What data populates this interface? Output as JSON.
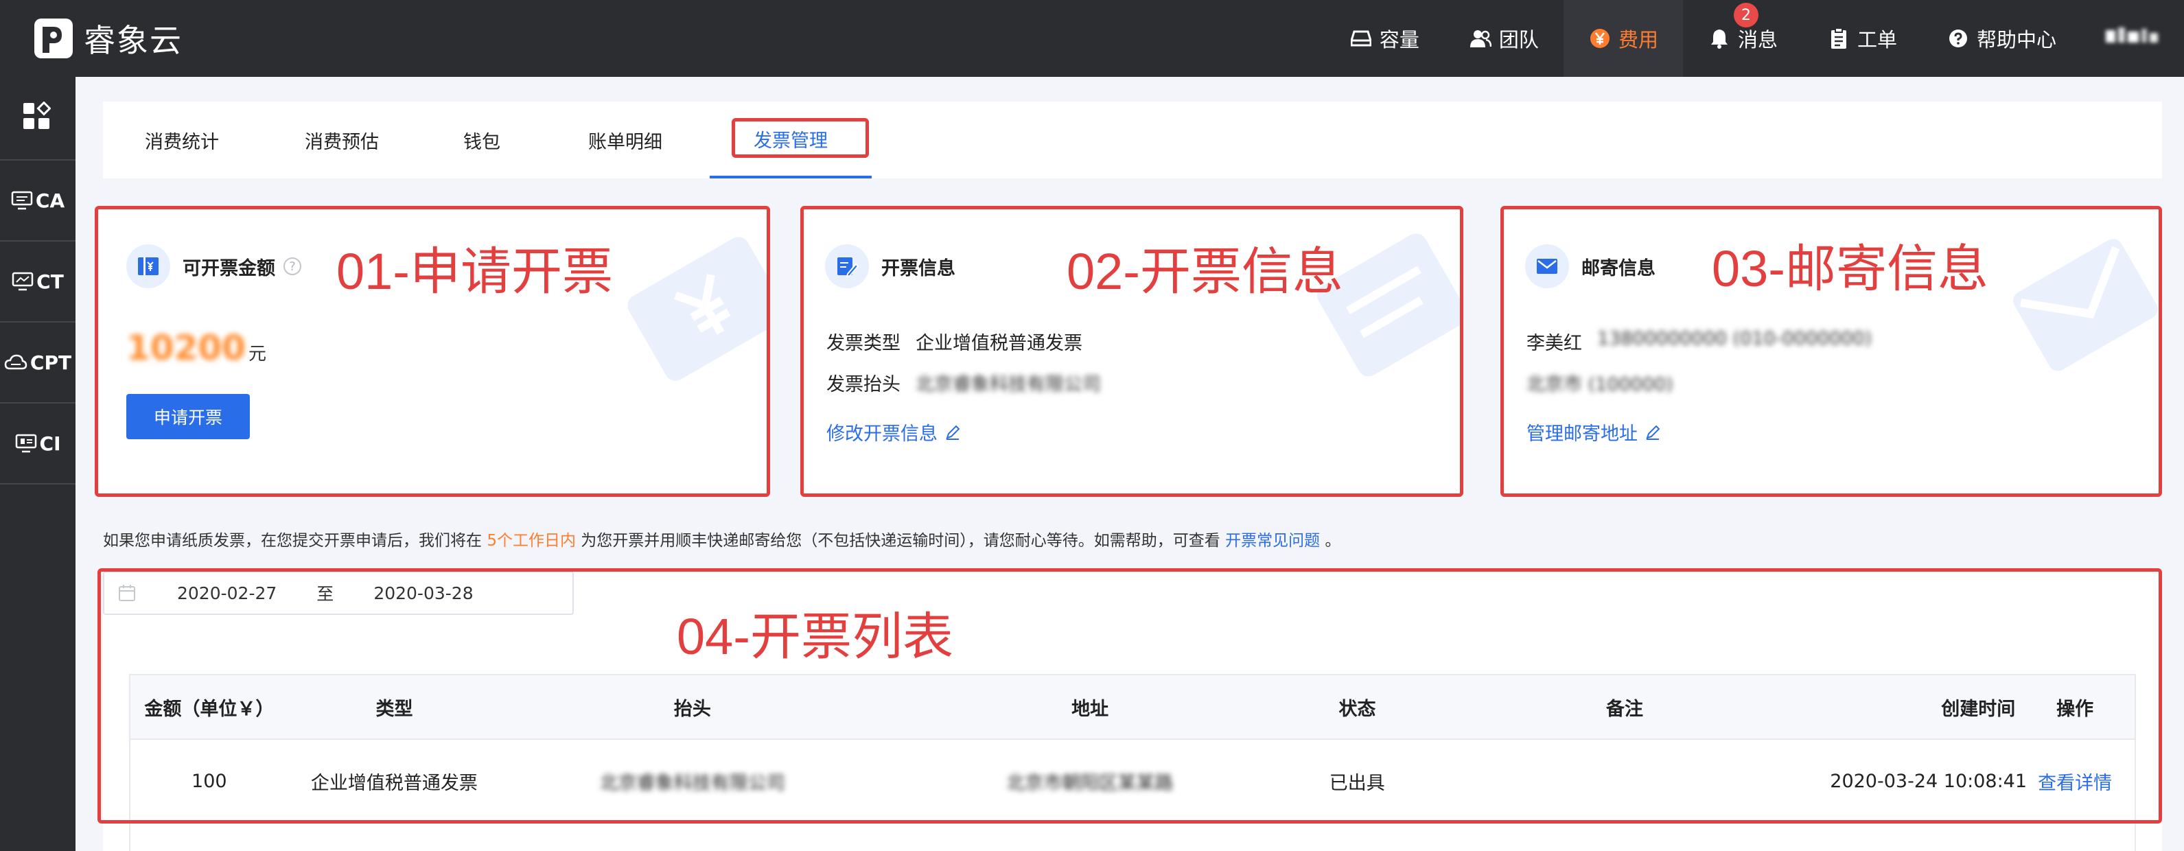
{
  "brand": {
    "name": "睿象云"
  },
  "topnav": {
    "items": [
      {
        "key": "capacity",
        "label": "容量",
        "icon": "disk-icon"
      },
      {
        "key": "team",
        "label": "团队",
        "icon": "team-icon"
      },
      {
        "key": "billing",
        "label": "费用",
        "icon": "yen-icon",
        "active": true
      },
      {
        "key": "messages",
        "label": "消息",
        "icon": "bell-icon",
        "badge": "2"
      },
      {
        "key": "tickets",
        "label": "工单",
        "icon": "clipboard-icon"
      },
      {
        "key": "help",
        "label": "帮助中心",
        "icon": "question-icon"
      }
    ]
  },
  "sidebar": {
    "items": [
      {
        "label": "",
        "icon": "apps-icon"
      },
      {
        "label": "CA",
        "icon": "monitor-icon"
      },
      {
        "label": "CT",
        "icon": "monitor-chart-icon"
      },
      {
        "label": "CPT",
        "icon": "cloud-icon"
      },
      {
        "label": "CI",
        "icon": "monitor-list-icon"
      }
    ]
  },
  "tabs": [
    "消费统计",
    "消费预估",
    "钱包",
    "账单明细",
    "发票管理"
  ],
  "active_tab": "发票管理",
  "cards": {
    "apply": {
      "title": "可开票金额",
      "annotation": "01-申请开票",
      "amount": "10200",
      "unit": "元",
      "button": "申请开票"
    },
    "invoice_info": {
      "title": "开票信息",
      "annotation": "02-开票信息",
      "type_label": "发票类型",
      "type_value": "企业增值税普通发票",
      "header_label": "发票抬头",
      "header_value": "北京睿象科技有限公司",
      "link": "修改开票信息"
    },
    "mailing": {
      "title": "邮寄信息",
      "annotation": "03-邮寄信息",
      "name": "李美红",
      "phone": "13800000000 (010-0000000)",
      "postcode": "北京市 (100000)",
      "link": "管理邮寄地址"
    }
  },
  "notice": {
    "part1": "如果您申请纸质发票，在您提交开票申请后，我们将在",
    "highlight": "5个工作日内",
    "part2": "为您开票并用顺丰快递邮寄给您（不包括快递运输时间），请您耐心等待。如需帮助，可查看",
    "link": "开票常见问题",
    "end": "。"
  },
  "list": {
    "annotation": "04-开票列表",
    "date_from": "2020-02-27",
    "date_sep": "至",
    "date_to": "2020-03-28",
    "columns": [
      "金额（单位￥）",
      "类型",
      "抬头",
      "地址",
      "状态",
      "备注",
      "创建时间",
      "操作"
    ],
    "rows": [
      {
        "amount": "100",
        "type": "企业增值税普通发票",
        "header": "北京睿象科技有限公司",
        "address": "北京市朝阳区某某路",
        "status": "已出具",
        "remark": "",
        "created": "2020-03-24 10:08:41",
        "action": "查看详情"
      }
    ]
  }
}
